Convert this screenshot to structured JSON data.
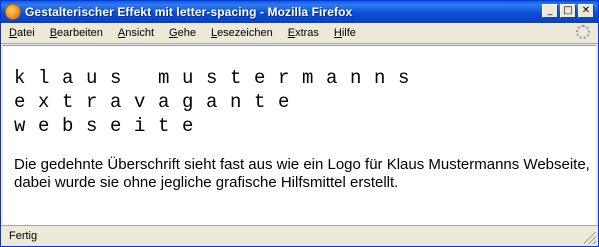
{
  "window": {
    "title": "Gestalterischer Effekt mit letter-spacing - Mozilla Firefox",
    "controls": {
      "minimize": "_",
      "maximize": "□",
      "close": "✕"
    }
  },
  "menu": {
    "items": [
      {
        "label": "Datei",
        "accel": "D",
        "rest": "atei"
      },
      {
        "label": "Bearbeiten",
        "accel": "B",
        "rest": "earbeiten"
      },
      {
        "label": "Ansicht",
        "accel": "A",
        "rest": "nsicht"
      },
      {
        "label": "Gehe",
        "accel": "G",
        "rest": "ehe"
      },
      {
        "label": "Lesezeichen",
        "accel": "L",
        "rest": "esezeichen"
      },
      {
        "label": "Extras",
        "accel": "E",
        "rest": "xtras"
      },
      {
        "label": "Hilfe",
        "accel": "H",
        "rest": "ilfe"
      }
    ]
  },
  "content": {
    "logo_lines": [
      "klaus mustermanns",
      "extravagante",
      "webseite"
    ],
    "paragraph": "Die gedehnte Überschrift sieht fast aus wie ein Logo für Klaus Mustermanns Webseite, dabei wurde sie ohne jegliche grafische Hilfsmittel erstellt."
  },
  "status": {
    "text": "Fertig"
  },
  "icons": {
    "app": "firefox-icon",
    "throbber": "throbber-icon",
    "grip": "resize-grip-icon"
  }
}
